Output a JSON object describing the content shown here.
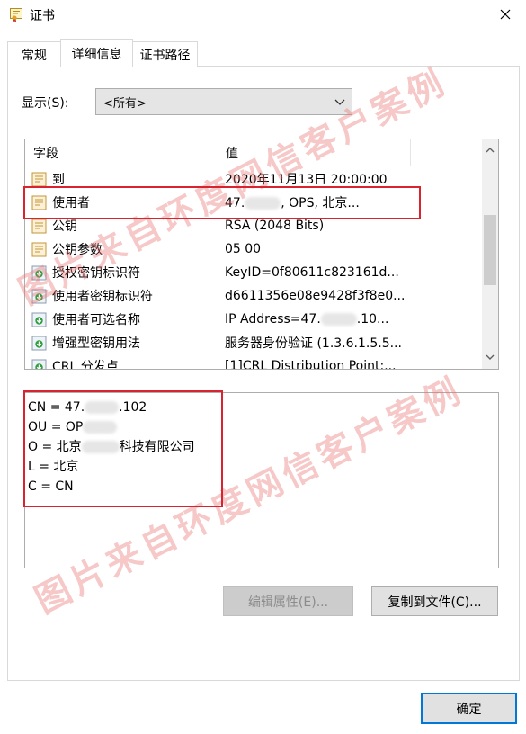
{
  "window": {
    "title": "证书"
  },
  "tabs": [
    {
      "label": "常规"
    },
    {
      "label": "详细信息"
    },
    {
      "label": "证书路径"
    }
  ],
  "show": {
    "label": "显示(S):",
    "selected": "<所有>"
  },
  "list": {
    "columns": [
      "字段",
      "值"
    ],
    "rows": [
      {
        "icon": "certificate-field-icon",
        "name": "到",
        "value_pre": "2020年11月13日 20:00:00",
        "value_post": ""
      },
      {
        "icon": "certificate-field-icon",
        "name": "使用者",
        "value_pre": "47.",
        "value_post": ", OPS, 北京..."
      },
      {
        "icon": "certificate-field-icon",
        "name": "公钥",
        "value_pre": "RSA (2048 Bits)",
        "value_post": ""
      },
      {
        "icon": "certificate-field-icon",
        "name": "公钥参数",
        "value_pre": "05 00",
        "value_post": ""
      },
      {
        "icon": "extension-field-icon",
        "name": "授权密钥标识符",
        "value_pre": "KeyID=0f80611c823161d...",
        "value_post": ""
      },
      {
        "icon": "extension-field-icon",
        "name": "使用者密钥标识符",
        "value_pre": "d6611356e08e9428f3f8e0...",
        "value_post": ""
      },
      {
        "icon": "extension-field-icon",
        "name": "使用者可选名称",
        "value_pre": "IP Address=47.",
        "value_post": ".10..."
      },
      {
        "icon": "extension-field-icon",
        "name": "增强型密钥用法",
        "value_pre": "服务器身份验证 (1.3.6.1.5.5...",
        "value_post": ""
      },
      {
        "icon": "extension-field-icon",
        "name": "CRL 分发点",
        "value_pre": "[1]CRL Distribution Point:...",
        "value_post": ""
      }
    ]
  },
  "detail": {
    "lines": [
      {
        "pre": "CN = 47.",
        "post": ".102"
      },
      {
        "pre": "OU = OP",
        "post": ""
      },
      {
        "pre": "O = 北京",
        "post": "科技有限公司"
      },
      {
        "pre": "L = 北京",
        "post": ""
      },
      {
        "pre": "C = CN",
        "post": ""
      }
    ]
  },
  "buttons": {
    "edit_properties": "编辑属性(E)...",
    "copy_to_file": "复制到文件(C)...",
    "ok": "确定"
  },
  "watermark": "图片来自环度网信客户案例",
  "colors": {
    "highlight": "#d9232e",
    "focus": "#0078d7",
    "watermark": "#e86e6e"
  }
}
